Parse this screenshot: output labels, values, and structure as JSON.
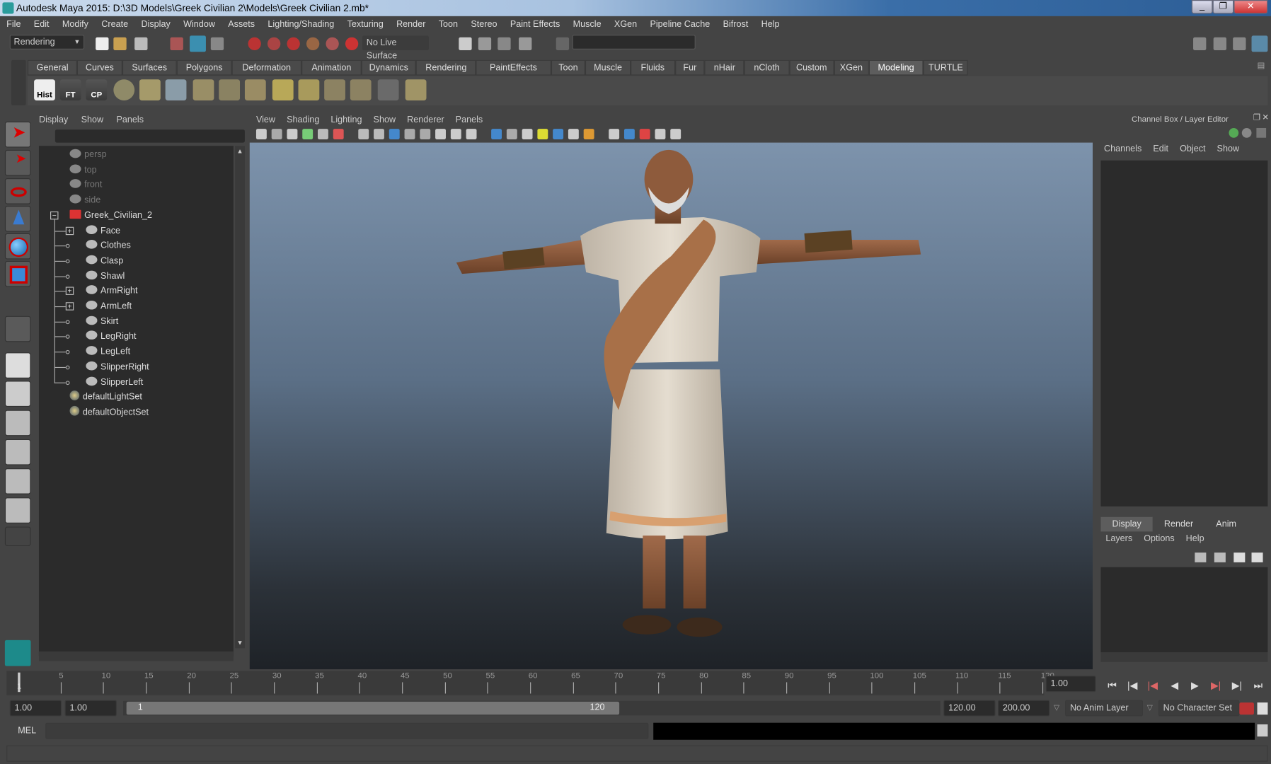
{
  "window": {
    "title": "Autodesk Maya 2015: D:\\3D Models\\Greek Civilian 2\\Models\\Greek Civilian 2.mb*"
  },
  "menu": [
    "File",
    "Edit",
    "Modify",
    "Create",
    "Display",
    "Window",
    "Assets",
    "Lighting/Shading",
    "Texturing",
    "Render",
    "Toon",
    "Stereo",
    "Paint Effects",
    "Muscle",
    "XGen",
    "Pipeline Cache",
    "Bifrost",
    "Help"
  ],
  "statusline": {
    "menu_set": "Rendering",
    "live_surface": "No Live Surface"
  },
  "shelf": {
    "tabs": [
      "General",
      "Curves",
      "Surfaces",
      "Polygons",
      "Deformation",
      "Animation",
      "Dynamics",
      "Rendering",
      "PaintEffects",
      "Toon",
      "Muscle",
      "Fluids",
      "Fur",
      "nHair",
      "nCloth",
      "Custom",
      "XGen",
      "Modeling",
      "TURTLE"
    ],
    "active": "Modeling",
    "buttons": [
      "Hist",
      "FT",
      "CP"
    ]
  },
  "outliner": {
    "menu": [
      "Display",
      "Show",
      "Panels"
    ],
    "cameras": [
      "persp",
      "top",
      "front",
      "side"
    ],
    "root": "Greek_Civilian_2",
    "children": [
      {
        "name": "Face",
        "expand": true
      },
      {
        "name": "Clothes",
        "expand": false
      },
      {
        "name": "Clasp",
        "expand": false
      },
      {
        "name": "Shawl",
        "expand": false
      },
      {
        "name": "ArmRight",
        "expand": true
      },
      {
        "name": "ArmLeft",
        "expand": true
      },
      {
        "name": "Skirt",
        "expand": false
      },
      {
        "name": "LegRight",
        "expand": false
      },
      {
        "name": "LegLeft",
        "expand": false
      },
      {
        "name": "SlipperRight",
        "expand": false
      },
      {
        "name": "SlipperLeft",
        "expand": false
      }
    ],
    "sets": [
      "defaultLightSet",
      "defaultObjectSet"
    ]
  },
  "viewport": {
    "menu": [
      "View",
      "Shading",
      "Lighting",
      "Show",
      "Renderer",
      "Panels"
    ]
  },
  "channelbox": {
    "title": "Channel Box / Layer Editor",
    "menu": [
      "Channels",
      "Edit",
      "Object",
      "Show"
    ],
    "layer_tabs": [
      "Display",
      "Render",
      "Anim"
    ],
    "active_layer_tab": "Display",
    "layer_menu": [
      "Layers",
      "Options",
      "Help"
    ]
  },
  "timeline": {
    "ticks": [
      "5",
      "10",
      "15",
      "20",
      "25",
      "30",
      "35",
      "40",
      "45",
      "50",
      "55",
      "60",
      "65",
      "70",
      "75",
      "80",
      "85",
      "90",
      "95",
      "100",
      "105",
      "110",
      "115",
      "120"
    ],
    "start_marker": "1",
    "current_time": "1.00"
  },
  "range": {
    "start": "1.00",
    "playback_start": "1.00",
    "slider_start": "1",
    "slider_end": "120",
    "playback_end": "120.00",
    "end": "200.00",
    "anim_layer": "No Anim Layer",
    "character_set": "No Character Set"
  },
  "commandline": {
    "label": "MEL"
  },
  "colors": {
    "accent": "#5d5d5d",
    "bg": "#444444",
    "field": "#2b2b2b"
  }
}
